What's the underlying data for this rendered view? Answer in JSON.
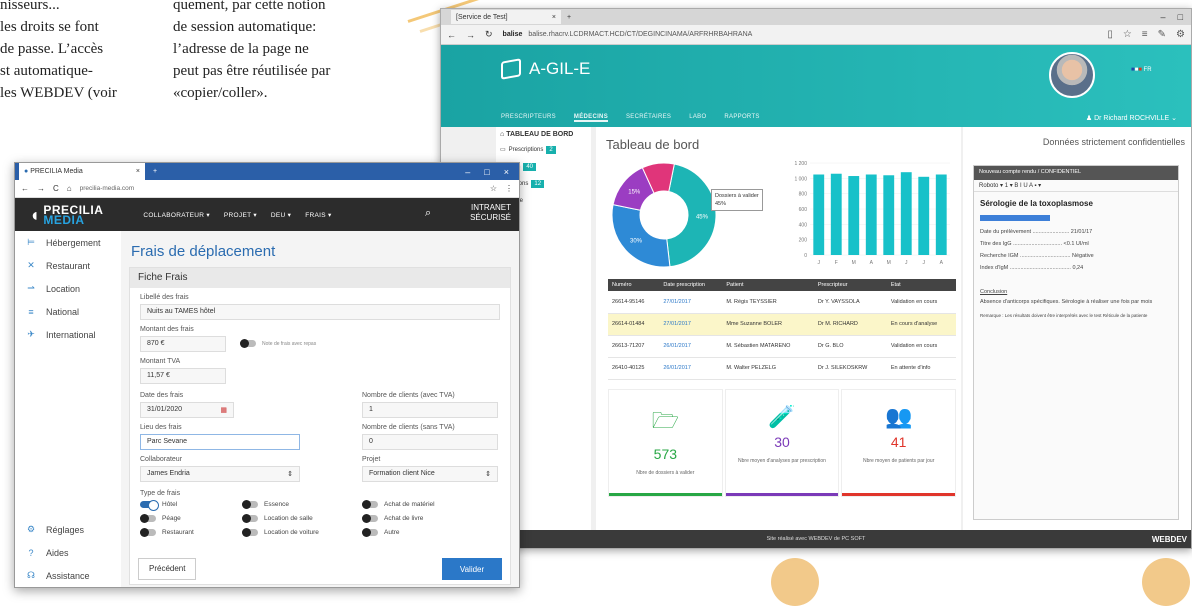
{
  "article": {
    "left_lines": [
      "nisseurs...",
      "les droits se font",
      "de passe. L’accès",
      "st automatique-",
      "les WEBDEV (voir"
    ],
    "right_lines": [
      "quement, par cette notion",
      "de session automatique:",
      "l’adresse de la page ne",
      "peut pas être réutilisée par",
      "«copier/coller»."
    ]
  },
  "browser_b": {
    "tab_title": "[Service de Test]",
    "url": "balise.rhacrv.LCDRMACT.HCD/CT/DEGINCINAMA/ARFRHRBAHRANA",
    "app": {
      "name": "A-GIL-E",
      "nav": [
        "PRESCRIPTEURS",
        "MÉDECINS",
        "SECRÉTAIRES",
        "LABO",
        "RAPPORTS"
      ],
      "nav_active_index": 1,
      "flag": "FR",
      "user": "Dr Richard ROCHVILLE",
      "sidebar": {
        "title": "TABLEAU DE BORD",
        "items": [
          {
            "label": "Prescriptions",
            "badge": "2"
          },
          {
            "label": "nalyses",
            "badge": "40"
          },
          {
            "label": "chantillons",
            "badge": "12"
          },
          {
            "label": "atalogue",
            "badge": ""
          },
          {
            "label": "sults",
            "badge": ""
          },
          {
            "label": "cteurs",
            "badge": ""
          },
          {
            "label": "atients",
            "badge": ""
          }
        ]
      },
      "dashboard_title": "Tableau de bord",
      "confidential": "Données strictement confidentielles",
      "pie_tooltip": [
        "Dossiers à valider",
        "45%"
      ],
      "table": {
        "headers": [
          "Numéro",
          "Date prescription",
          "Patient",
          "Prescripteur",
          "Etat"
        ],
        "rows": [
          [
            "26614-95146",
            "27/01/2017",
            "M. Régis TEYSSIER",
            "Dr Y. VAYSSOLA",
            "Validation en cours"
          ],
          [
            "26614-01484",
            "27/01/2017",
            "Mme Suzanne BOLER",
            "Dr M. RICHARD",
            "En cours d'analyse"
          ],
          [
            "26613-71207",
            "26/01/2017",
            "M. Sébastien MATARENO",
            "Dr G. BLO",
            "Validation en cours"
          ],
          [
            "26410-40125",
            "26/01/2017",
            "M. Walter PELZELG",
            "Dr J. SILEKOSKRW",
            "En attente d'info"
          ]
        ]
      },
      "cards": [
        {
          "value": "573",
          "label": "Nbre de dossiers à valider",
          "color": "#28a745",
          "icon": "🗁"
        },
        {
          "value": "30",
          "label": "Nbre moyen d'analyses par prescription",
          "color": "#7b3ab8",
          "icon": "🧪"
        },
        {
          "value": "41",
          "label": "Nbre moyen de patients par jour",
          "color": "#e0352b",
          "icon": "👥"
        }
      ],
      "report": {
        "panel_title": "Nouveau compte rendu / CONFIDENTIEL",
        "toolbar": "Roboto  ▾ 1 ▾ B I U A ▪ ▾",
        "heading": "Sérologie de la toxoplasmose",
        "lines": [
          "Date du prélèvement ........................ 21/01/17",
          "Titre des IgG ................................ <0.1 UI/ml",
          "Recherche IGM ................................. Négative",
          "Index d'IgM ........................................ 0,24"
        ],
        "conclusion_title": "Conclusion",
        "conclusion": "Absence d'anticorps spécifiques. Sérologie à réaliser une fois par mois",
        "remark": "Remarque : Les résultats doivent être interprétés avec le test Réticule de la patiente"
      },
      "footer": "Site réalisé avec WEBDEV de PC SOFT",
      "footer_logo": "WEBDEV"
    }
  },
  "chart_data": [
    {
      "type": "pie",
      "title": "",
      "categories": [
        "Dossiers à valider",
        "segment-2",
        "segment-3",
        "segment-4"
      ],
      "values": [
        45,
        30,
        15,
        10
      ],
      "colors": [
        "#1db5b5",
        "#2e8ad6",
        "#9b3dc2",
        "#e0357a"
      ],
      "labels": [
        "45%",
        "30%",
        "15%",
        ""
      ]
    },
    {
      "type": "bar",
      "title": "",
      "categories": [
        "J",
        "F",
        "M",
        "A",
        "M",
        "J",
        "J",
        "A"
      ],
      "values": [
        1050,
        1060,
        1030,
        1050,
        1040,
        1080,
        1020,
        1050
      ],
      "ylim": [
        0,
        1200
      ],
      "yticks": [
        "1 200",
        "1 000",
        "800",
        "600",
        "400",
        "200",
        "0"
      ],
      "color": "#17c1c9"
    }
  ],
  "browser_a": {
    "tab_title": "PRECILIA Media",
    "url": "precilia-media.com",
    "logo_top": "PRECILIA",
    "logo_bottom": "MEDIA",
    "nav": [
      "COLLABORATEUR ▾",
      "PROJET ▾",
      "DEU ▾",
      "FRAIS ▾"
    ],
    "intranet": [
      "INTRANET",
      "SÉCURISÉ"
    ],
    "sidebar": [
      {
        "label": "Hébergement",
        "icon": "bed-icon",
        "glyph": "⊨"
      },
      {
        "label": "Restaurant",
        "icon": "fork-icon",
        "glyph": "✕"
      },
      {
        "label": "Location",
        "icon": "car-icon",
        "glyph": "⇀"
      },
      {
        "label": "National",
        "icon": "train-icon",
        "glyph": "≡"
      },
      {
        "label": "International",
        "icon": "plane-icon",
        "glyph": "✈"
      }
    ],
    "sidebar_bottom": [
      {
        "label": "Réglages",
        "icon": "gear-icon",
        "glyph": "⚙"
      },
      {
        "label": "Aides",
        "icon": "help-icon",
        "glyph": "?"
      },
      {
        "label": "Assistance",
        "icon": "headset-icon",
        "glyph": "☊"
      }
    ],
    "page_title": "Frais de déplacement",
    "section_title": "Fiche Frais",
    "fields": {
      "libelle_label": "Libellé des frais",
      "libelle_value": "Nuits au TAMES hôtel",
      "montant_label": "Montant des frais",
      "montant_value": "870 €",
      "note_toggle": "Note de frais avec repas",
      "tva_label": "Montant TVA",
      "tva_value": "11,57 €",
      "date_label": "Date des frais",
      "date_value": "31/01/2020",
      "clients_tva_label": "Nombre de clients (avec TVA)",
      "clients_tva_value": "1",
      "lieu_label": "Lieu des frais",
      "lieu_value": "Parc Sevane",
      "clients_sans_label": "Nombre de clients (sans TVA)",
      "clients_sans_value": "0",
      "collab_label": "Collaborateur",
      "collab_value": "James Endria",
      "projet_label": "Projet",
      "projet_value": "Formation client Nice",
      "type_label": "Type de frais"
    },
    "type_toggles": [
      [
        "Hôtel",
        "Essence",
        "Achat de matériel"
      ],
      [
        "Péage",
        "Location de salle",
        "Achat de livre"
      ],
      [
        "Restaurant",
        "Location de voiture",
        "Autre"
      ]
    ],
    "prev_button": "Précédent",
    "validate_button": "Valider"
  }
}
